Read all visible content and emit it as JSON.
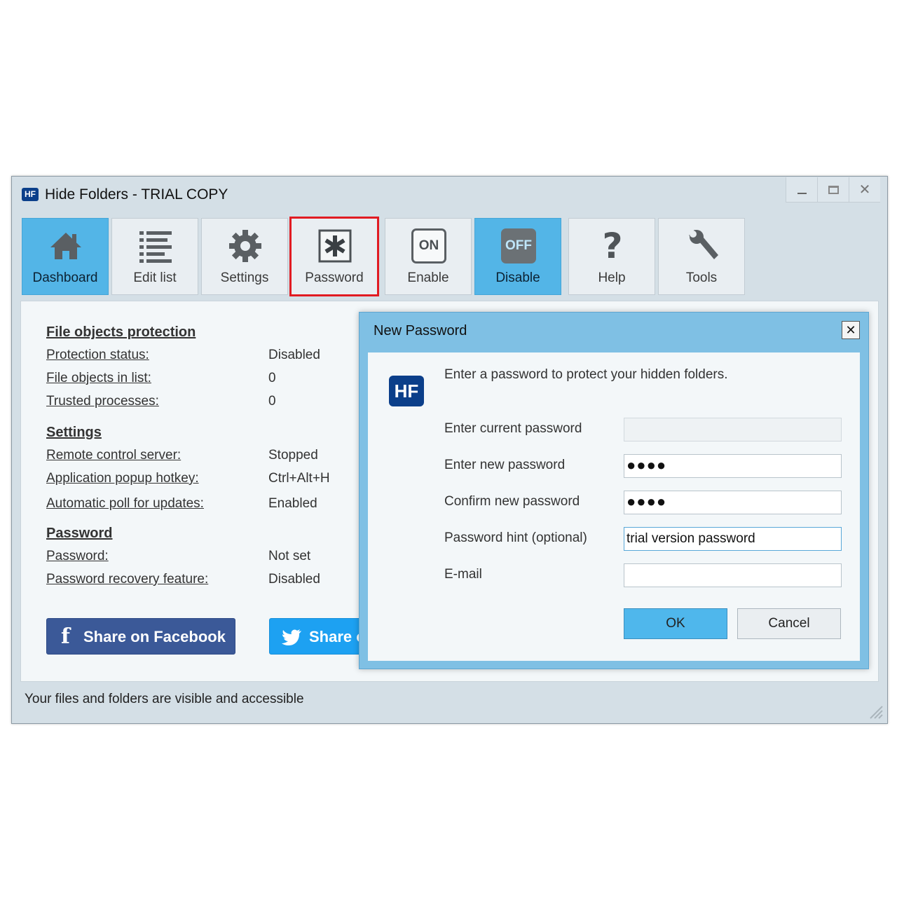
{
  "window": {
    "icon_text": "HF",
    "title": "Hide Folders - TRIAL COPY"
  },
  "toolbar": {
    "items": [
      {
        "label": "Dashboard",
        "icon": "home-icon",
        "state": "active"
      },
      {
        "label": "Edit list",
        "icon": "list-icon",
        "state": "normal"
      },
      {
        "label": "Settings",
        "icon": "gear-icon",
        "state": "normal"
      },
      {
        "label": "Password",
        "icon": "asterisk-icon",
        "state": "highlighted"
      },
      {
        "label": "Enable",
        "icon": "on-icon",
        "icon_text": "ON",
        "state": "normal"
      },
      {
        "label": "Disable",
        "icon": "off-icon",
        "icon_text": "OFF",
        "state": "active"
      },
      {
        "label": "Help",
        "icon": "question-icon",
        "icon_text": "?",
        "state": "normal"
      },
      {
        "label": "Tools",
        "icon": "wrench-icon",
        "state": "normal"
      }
    ]
  },
  "dashboard": {
    "file_objects": {
      "title": "File objects protection",
      "protection_status_label": "Protection status:",
      "protection_status_value": "Disabled",
      "file_objects_label": "File objects in list:",
      "file_objects_value": "0",
      "trusted_label": "Trusted processes:",
      "trusted_value": "0"
    },
    "settings": {
      "title": "Settings",
      "remote_label": "Remote control server:",
      "remote_value": "Stopped",
      "hotkey_label": "Application popup hotkey:",
      "hotkey_value": "Ctrl+Alt+H",
      "poll_label": "Automatic poll for updates:",
      "poll_value": "Enabled"
    },
    "password": {
      "title": "Password",
      "password_label": "Password:",
      "password_value": "Not set",
      "recovery_label": "Password recovery feature:",
      "recovery_value": "Disabled"
    },
    "share_facebook": "Share on Facebook",
    "share_facebook_glyph": "f",
    "share_twitter": "Share on Twitter"
  },
  "statusbar": {
    "text": "Your files and folders are visible and accessible"
  },
  "dialog": {
    "title": "New Password",
    "close_glyph": "✕",
    "logo_text": "HF",
    "intro": "Enter a password to protect your hidden folders.",
    "current_label": "Enter current password",
    "current_value": "",
    "new_label": "Enter new password",
    "new_value": "●●●●",
    "confirm_label": "Confirm new password",
    "confirm_value": "●●●●",
    "hint_label": "Password hint (optional)",
    "hint_value": "trial version password",
    "email_label": "E-mail",
    "email_value": "",
    "ok_label": "OK",
    "cancel_label": "Cancel"
  },
  "colors": {
    "accent": "#53b5e7",
    "highlight": "#e11b22",
    "facebook": "#3b5998",
    "twitter": "#1da1f2",
    "brand": "#0b3f8a"
  }
}
